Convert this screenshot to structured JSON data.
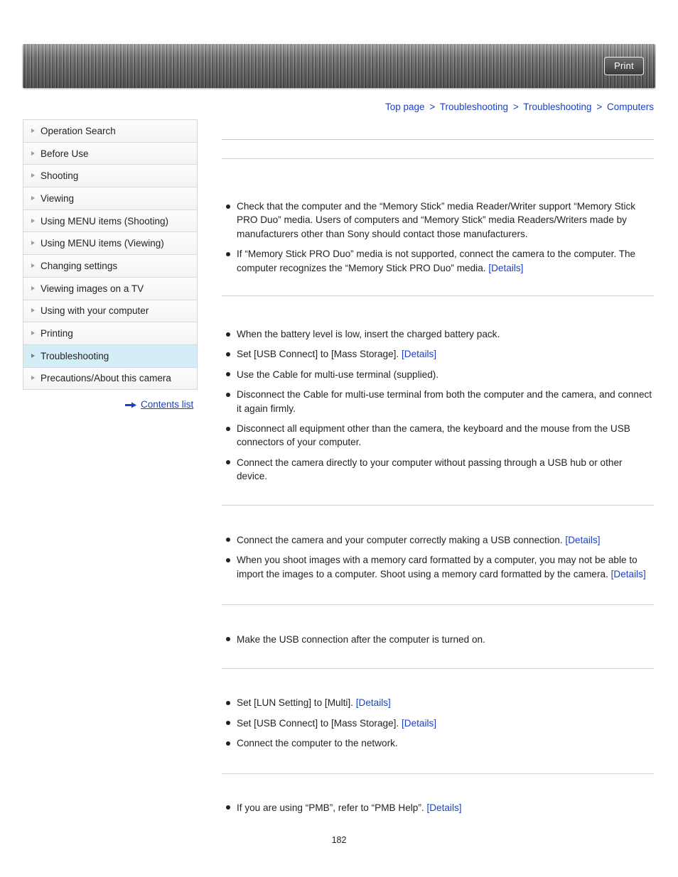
{
  "header": {
    "print_label": "Print",
    "print_icon": "print-icon"
  },
  "breadcrumb": {
    "items": [
      {
        "label": "Top page"
      },
      {
        "label": "Troubleshooting"
      },
      {
        "label": "Troubleshooting"
      },
      {
        "label": "Computers"
      }
    ],
    "separator": ">"
  },
  "sidebar": {
    "items": [
      {
        "label": "Operation Search",
        "active": false
      },
      {
        "label": "Before Use",
        "active": false
      },
      {
        "label": "Shooting",
        "active": false
      },
      {
        "label": "Viewing",
        "active": false
      },
      {
        "label": "Using MENU items (Shooting)",
        "active": false
      },
      {
        "label": "Using MENU items (Viewing)",
        "active": false
      },
      {
        "label": "Changing settings",
        "active": false
      },
      {
        "label": "Viewing images on a TV",
        "active": false
      },
      {
        "label": "Using with your computer",
        "active": false
      },
      {
        "label": "Printing",
        "active": false
      },
      {
        "label": "Troubleshooting",
        "active": true
      },
      {
        "label": "Precautions/About this camera",
        "active": false
      }
    ],
    "contents_list_label": "Contents list"
  },
  "main": {
    "sections": [
      {
        "title": "",
        "items": [
          {
            "parts": [
              {
                "t": "text",
                "v": "Check that the computer and the “Memory Stick” media Reader/Writer support “Memory Stick PRO Duo” media. Users of computers and “Memory Stick” media Readers/Writers made by manufacturers other than Sony should contact those manufacturers."
              }
            ]
          },
          {
            "parts": [
              {
                "t": "text",
                "v": "If “Memory Stick PRO Duo” media is not supported, connect the camera to the computer. The computer recognizes the “Memory Stick PRO Duo” media. "
              },
              {
                "t": "link",
                "v": "[Details]"
              }
            ]
          }
        ]
      },
      {
        "title": "",
        "items": [
          {
            "parts": [
              {
                "t": "text",
                "v": "When the battery level is low, insert the charged battery pack."
              }
            ]
          },
          {
            "parts": [
              {
                "t": "text",
                "v": "Set [USB Connect] to [Mass Storage]. "
              },
              {
                "t": "link",
                "v": "[Details]"
              }
            ]
          },
          {
            "parts": [
              {
                "t": "text",
                "v": "Use the Cable for multi-use terminal (supplied)."
              }
            ]
          },
          {
            "parts": [
              {
                "t": "text",
                "v": "Disconnect the Cable for multi-use terminal from both the computer and the camera, and connect it again firmly."
              }
            ]
          },
          {
            "parts": [
              {
                "t": "text",
                "v": "Disconnect all equipment other than the camera, the keyboard and the mouse from the USB connectors of your computer."
              }
            ]
          },
          {
            "parts": [
              {
                "t": "text",
                "v": "Connect the camera directly to your computer without passing through a USB hub or other device."
              }
            ]
          }
        ]
      },
      {
        "title": "",
        "items": [
          {
            "parts": [
              {
                "t": "text",
                "v": "Connect the camera and your computer correctly making a USB connection. "
              },
              {
                "t": "link",
                "v": "[Details]"
              }
            ]
          },
          {
            "parts": [
              {
                "t": "text",
                "v": "When you shoot images with a memory card formatted by a computer, you may not be able to import the images to a computer. Shoot using a memory card formatted by the camera. "
              },
              {
                "t": "link",
                "v": "[Details]"
              }
            ]
          }
        ]
      },
      {
        "title": "",
        "items": [
          {
            "parts": [
              {
                "t": "text",
                "v": "Make the USB connection after the computer is turned on."
              }
            ]
          }
        ]
      },
      {
        "title": "",
        "items": [
          {
            "parts": [
              {
                "t": "text",
                "v": "Set [LUN Setting] to [Multi]. "
              },
              {
                "t": "link",
                "v": "[Details]"
              }
            ]
          },
          {
            "parts": [
              {
                "t": "text",
                "v": "Set [USB Connect] to [Mass Storage]. "
              },
              {
                "t": "link",
                "v": "[Details]"
              }
            ]
          },
          {
            "parts": [
              {
                "t": "text",
                "v": "Connect the computer to the network."
              }
            ]
          }
        ]
      },
      {
        "title": "",
        "items": [
          {
            "parts": [
              {
                "t": "text",
                "v": "If you are using “PMB”, refer to “PMB Help”. "
              },
              {
                "t": "link",
                "v": "[Details]"
              }
            ]
          }
        ]
      }
    ]
  },
  "footer": {
    "page_number": "182"
  }
}
